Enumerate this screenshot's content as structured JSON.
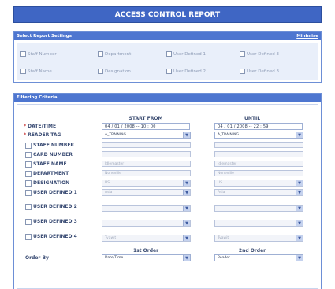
{
  "header": {
    "title": "ACCESS CONTROL REPORT"
  },
  "settings": {
    "title": "Select Report Settings",
    "toggle_label": "Minimise",
    "items": [
      {
        "label": "Staff Number"
      },
      {
        "label": "Department"
      },
      {
        "label": "User Defined 1"
      },
      {
        "label": "User Defined 3"
      },
      {
        "label": "Staff Name"
      },
      {
        "label": "Designation"
      },
      {
        "label": "User Defined 2"
      },
      {
        "label": "User Defined 3"
      }
    ]
  },
  "filter": {
    "title": "Filtering Criteria",
    "col_start": "START FROM",
    "col_until": "UNTIL",
    "date_label": "DATE/TIME",
    "reader_label": "READER TAG",
    "start_date": {
      "day": "04",
      "month": "01",
      "year": "2008",
      "hour": "10",
      "minute": "00"
    },
    "until_date": {
      "day": "04",
      "month": "01",
      "year": "2008",
      "hour": "22",
      "minute": "59"
    },
    "reader_start": "A_TRAINING",
    "reader_until": "A_TRAINING",
    "rows": [
      {
        "label": "STAFF NUMBER",
        "start": "",
        "until": ""
      },
      {
        "label": "CARD NUMBER",
        "start": "",
        "until": ""
      },
      {
        "label": "STAFF NAME",
        "start": "Idlemaster",
        "until": "Idlemaster"
      },
      {
        "label": "DEPARTMENT",
        "start": "Noneville",
        "until": "Noneville"
      },
      {
        "label": "DESIGNATION",
        "start": "US",
        "until": "US"
      },
      {
        "label": "USER DEFINED 1",
        "start": "Asia",
        "until": "Asia"
      },
      {
        "label": "USER DEFINED 2",
        "start": "",
        "until": ""
      },
      {
        "label": "USER DEFINED 3",
        "start": "",
        "until": ""
      },
      {
        "label": "USER DEFINED 4",
        "start": "Tyawit",
        "until": "Tyawit"
      }
    ],
    "order": {
      "label": "Order By",
      "first_title": "1st Order",
      "second_title": "2nd Order",
      "first_value": "Date/Time",
      "second_value": "Reader"
    }
  }
}
